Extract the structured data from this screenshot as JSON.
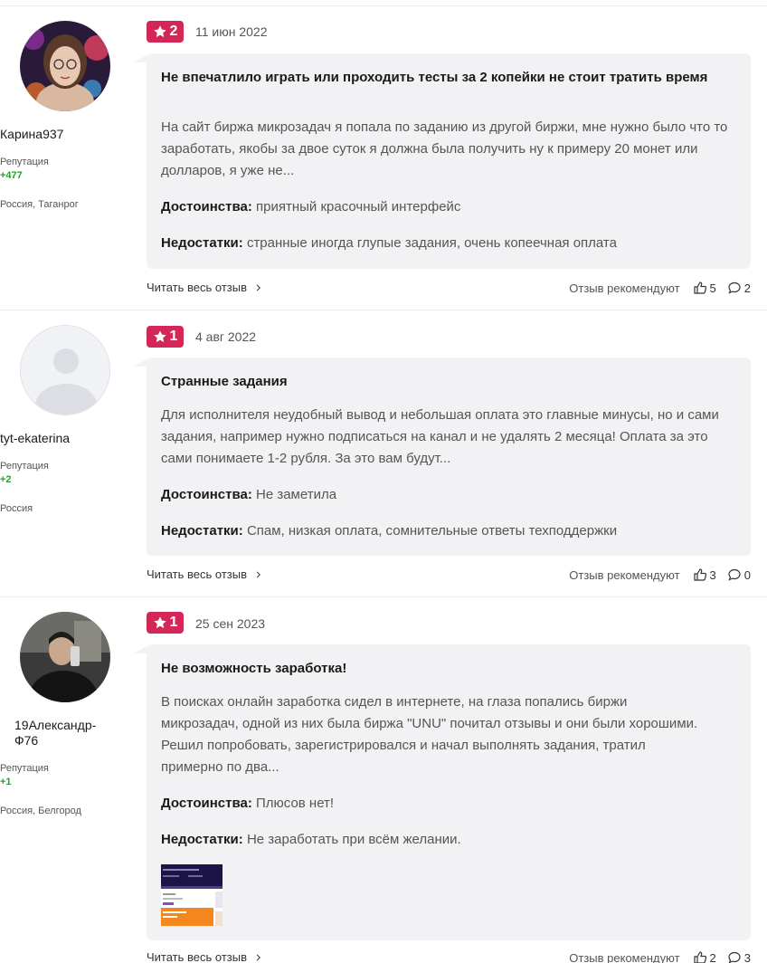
{
  "reviews": [
    {
      "author": "Карина937",
      "reputation_label": "Репутация",
      "reputation": "+477",
      "location": "Россия, Таганрог",
      "rating": "2",
      "date": "11 июн 2022",
      "title": "Не впечатлило играть или проходить тесты за 2 копейки не стоит тратить время",
      "text": "На сайт биржа микрозадач я попала по заданию из другой биржи, мне нужно было что то заработать, якобы за двое суток я должна была получить ну к примеру 20 монет или долларов, я уже не...",
      "pros_label": "Достоинства:",
      "pros": "приятный красочный интерфейс",
      "cons_label": "Недостатки:",
      "cons": "странные иногда глупые задания, очень копеечная оплата",
      "read_more": "Читать весь отзыв",
      "recommend_label": "Отзыв рекомендуют",
      "likes": "5",
      "comments": "2"
    },
    {
      "author": "tyt-ekaterina",
      "reputation_label": "Репутация",
      "reputation": "+2",
      "location": "Россия",
      "rating": "1",
      "date": "4 авг 2022",
      "title": "Странные задания",
      "text": "Для исполнителя неудобный вывод и небольшая оплата это главные минусы, но и сами задания, например нужно подписаться на канал и не удалять 2 месяца! Оплата за это сами понимаете 1-2 рубля. За это вам будут...",
      "pros_label": "Достоинства:",
      "pros": "Не заметила",
      "cons_label": "Недостатки:",
      "cons": "Спам, низкая оплата, сомнительные ответы техподдержки",
      "read_more": "Читать весь отзыв",
      "recommend_label": "Отзыв рекомендуют",
      "likes": "3",
      "comments": "0"
    },
    {
      "author": "19Александр-Ф76",
      "reputation_label": "Репутация",
      "reputation": "+1",
      "location": "Россия, Белгород",
      "rating": "1",
      "date": "25 сен 2023",
      "title": "Не возможность заработка!",
      "text": "В поисках онлайн заработка сидел в интернете, на глаза попались биржи микрозадач, одной из них была биржа \"UNU\" почитал отзывы и они были хорошими. Решил попробовать, зарегистрировался и начал выполнять задания, тратил примерно по два...",
      "pros_label": "Достоинства:",
      "pros": "Плюсов нет!",
      "cons_label": "Недостатки:",
      "cons": "Не заработать при всём желании.",
      "read_more": "Читать весь отзыв",
      "recommend_label": "Отзыв рекомендуют",
      "likes": "2",
      "comments": "3"
    }
  ],
  "colors": {
    "rating_badge": "#d52757",
    "reputation": "#1ea52a",
    "bubble": "#f2f2f4"
  }
}
